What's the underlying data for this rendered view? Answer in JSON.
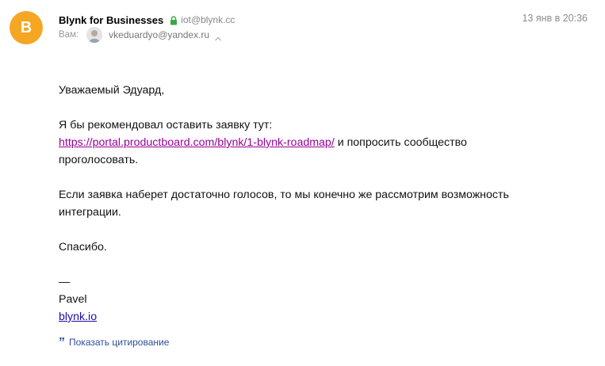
{
  "header": {
    "avatar_letter": "B",
    "avatar_color": "#f5a623",
    "sender_name": "Blynk for Businesses",
    "sender_email": "iot@blynk.cc",
    "date": "13 янв в 20:36",
    "to_label": "Вам:",
    "recipient_email": "vkeduardyo@yandex.ru"
  },
  "message": {
    "greeting": "Уважаемый Эдуард,",
    "line1": "Я бы рекомендовал оставить заявку тут:",
    "link": "https://portal.productboard.com/blynk/1-blynk-roadmap/",
    "line2_after_link": " и попросить сообщество",
    "line3": "проголосовать.",
    "para2_line1": "Если заявка наберет достаточно голосов, то мы конечно же рассмотрим возможность",
    "para2_line2": "интеграции.",
    "thanks": "Спасибо.",
    "signature_dash": "—",
    "signature_name": "Pavel",
    "signature_link": "blynk.io"
  },
  "footer": {
    "show_quote_label": "Показать цитирование",
    "quote_icon": "quote-icon"
  }
}
